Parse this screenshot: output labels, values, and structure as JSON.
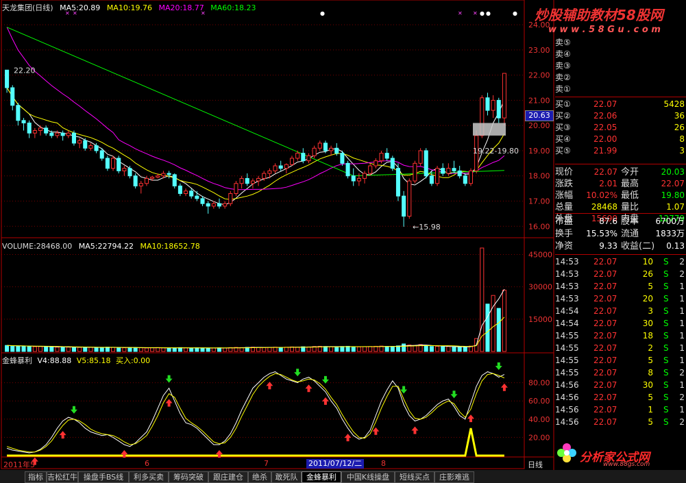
{
  "chart_data": [
    {
      "type": "candlestick",
      "title": "天龙集团(日线)",
      "ma_legend": [
        {
          "label": "MA5:20.89",
          "color": "#ffffff"
        },
        {
          "label": "MA10:19.76",
          "color": "#ffff00"
        },
        {
          "label": "MA20:18.77",
          "color": "#ff00ff"
        },
        {
          "label": "MA60:18.23",
          "color": "#00ff00"
        }
      ],
      "ylim": [
        15.6,
        24.6
      ],
      "yticks": [
        "24.00",
        "23.00",
        "22.00",
        "21.00",
        "20.00",
        "19.00",
        "18.00",
        "17.00",
        "16.00"
      ],
      "current_price": "20.63",
      "annotations": [
        "22.20",
        "19.22-19.80",
        "←15.98"
      ],
      "ohlc": [
        [
          22.2,
          22.2,
          21.3,
          21.5
        ],
        [
          21.5,
          21.6,
          20.6,
          20.8
        ],
        [
          20.8,
          20.9,
          20.0,
          20.2
        ],
        [
          20.2,
          20.3,
          19.8,
          20.1
        ],
        [
          20.1,
          20.2,
          19.5,
          19.7
        ],
        [
          19.7,
          19.9,
          19.5,
          19.8
        ],
        [
          19.8,
          20.0,
          19.6,
          19.9
        ],
        [
          19.9,
          20.0,
          19.6,
          19.7
        ],
        [
          19.7,
          19.8,
          19.5,
          19.6
        ],
        [
          19.6,
          19.8,
          19.5,
          19.7
        ],
        [
          19.7,
          19.8,
          19.4,
          19.6
        ],
        [
          19.6,
          19.8,
          19.5,
          19.7
        ],
        [
          19.7,
          19.8,
          19.2,
          19.3
        ],
        [
          19.3,
          19.5,
          19.1,
          19.4
        ],
        [
          19.4,
          19.5,
          19.0,
          19.1
        ],
        [
          19.1,
          19.3,
          19.0,
          19.2
        ],
        [
          19.2,
          19.3,
          18.9,
          19.0
        ],
        [
          19.0,
          19.1,
          18.6,
          18.7
        ],
        [
          18.7,
          18.8,
          18.2,
          18.3
        ],
        [
          18.3,
          18.8,
          18.2,
          18.7
        ],
        [
          18.7,
          18.8,
          18.1,
          18.2
        ],
        [
          18.2,
          18.4,
          18.0,
          18.3
        ],
        [
          18.3,
          18.4,
          17.9,
          18.0
        ],
        [
          18.0,
          18.1,
          17.5,
          17.6
        ],
        [
          17.6,
          17.8,
          17.3,
          17.7
        ],
        [
          17.7,
          18.0,
          17.6,
          17.9
        ],
        [
          17.9,
          18.0,
          17.8,
          17.95
        ],
        [
          17.95,
          18.1,
          17.9,
          18.0
        ],
        [
          18.0,
          18.2,
          17.9,
          18.1
        ],
        [
          18.1,
          18.2,
          17.9,
          18.05
        ],
        [
          18.05,
          18.1,
          17.5,
          17.6
        ],
        [
          17.6,
          17.7,
          17.2,
          17.3
        ],
        [
          17.3,
          17.5,
          17.2,
          17.4
        ],
        [
          17.4,
          17.5,
          17.1,
          17.2
        ],
        [
          17.2,
          17.4,
          17.0,
          17.1
        ],
        [
          17.1,
          17.2,
          16.8,
          16.9
        ],
        [
          16.9,
          17.0,
          16.5,
          16.8
        ],
        [
          16.8,
          17.0,
          16.7,
          16.9
        ],
        [
          16.9,
          17.1,
          16.7,
          16.8
        ],
        [
          16.8,
          17.0,
          16.7,
          16.9
        ],
        [
          16.9,
          17.4,
          16.8,
          17.3
        ],
        [
          17.3,
          17.8,
          17.2,
          17.7
        ],
        [
          17.7,
          18.0,
          17.5,
          17.9
        ],
        [
          17.9,
          18.1,
          17.6,
          17.7
        ],
        [
          17.7,
          17.9,
          17.5,
          17.8
        ],
        [
          17.8,
          18.0,
          17.6,
          17.9
        ],
        [
          17.9,
          18.2,
          17.8,
          18.1
        ],
        [
          18.1,
          18.3,
          17.9,
          18.2
        ],
        [
          18.2,
          18.5,
          18.1,
          18.4
        ],
        [
          18.4,
          18.6,
          18.2,
          18.3
        ],
        [
          18.3,
          18.5,
          18.1,
          18.45
        ],
        [
          18.45,
          18.8,
          18.4,
          18.7
        ],
        [
          18.7,
          19.0,
          18.6,
          18.9
        ],
        [
          18.9,
          19.1,
          18.5,
          18.6
        ],
        [
          18.6,
          18.9,
          18.5,
          18.8
        ],
        [
          18.8,
          19.2,
          18.7,
          19.1
        ],
        [
          19.1,
          19.4,
          19.0,
          19.3
        ],
        [
          19.3,
          19.4,
          18.9,
          19.0
        ],
        [
          19.0,
          19.2,
          18.8,
          19.1
        ],
        [
          19.1,
          19.3,
          18.8,
          18.9
        ],
        [
          18.9,
          19.0,
          18.4,
          18.5
        ],
        [
          18.5,
          18.6,
          17.9,
          18.0
        ],
        [
          18.0,
          18.3,
          17.6,
          17.8
        ],
        [
          17.8,
          18.1,
          17.6,
          17.9
        ],
        [
          17.9,
          18.2,
          17.7,
          18.1
        ],
        [
          18.1,
          18.5,
          18.0,
          18.4
        ],
        [
          18.4,
          18.7,
          18.3,
          18.6
        ],
        [
          18.6,
          19.0,
          18.5,
          18.9
        ],
        [
          18.9,
          19.1,
          18.6,
          18.7
        ],
        [
          18.7,
          18.8,
          18.2,
          18.3
        ],
        [
          18.3,
          18.5,
          17.0,
          17.2
        ],
        [
          17.2,
          17.4,
          15.98,
          16.4
        ],
        [
          16.4,
          17.9,
          16.3,
          17.8
        ],
        [
          17.8,
          18.6,
          17.7,
          18.5
        ],
        [
          18.5,
          19.1,
          18.4,
          19.0
        ],
        [
          19.0,
          19.1,
          17.9,
          18.0
        ],
        [
          18.0,
          18.2,
          17.6,
          17.7
        ],
        [
          17.7,
          18.4,
          17.6,
          18.3
        ],
        [
          18.3,
          18.5,
          18.0,
          18.1
        ],
        [
          18.1,
          18.5,
          18.0,
          18.3
        ],
        [
          18.3,
          18.6,
          18.1,
          18.2
        ],
        [
          18.2,
          18.4,
          17.9,
          18.0
        ],
        [
          18.0,
          18.1,
          17.6,
          17.7
        ],
        [
          17.7,
          18.3,
          17.6,
          18.2
        ],
        [
          18.2,
          19.8,
          18.1,
          19.6
        ],
        [
          19.6,
          21.2,
          19.5,
          21.1
        ],
        [
          21.1,
          21.3,
          20.4,
          20.6
        ],
        [
          20.6,
          21.2,
          20.3,
          21.0
        ],
        [
          21.0,
          21.1,
          20.1,
          20.3
        ],
        [
          20.3,
          22.07,
          20.0,
          22.07
        ]
      ]
    },
    {
      "type": "bar",
      "title": "VOLUME:28468.00",
      "ma_legend": [
        {
          "label": "MA5:22794.22",
          "color": "#ffffff"
        },
        {
          "label": "MA10:18652.78",
          "color": "#ffff00"
        }
      ],
      "ylim": [
        0,
        48000
      ],
      "yticks": [
        "45000",
        "30000",
        "15000"
      ],
      "values": [
        2800,
        2600,
        2500,
        2400,
        2300,
        2200,
        2300,
        2200,
        2100,
        2000,
        2100,
        2000,
        1900,
        1900,
        2000,
        1900,
        1800,
        1800,
        2000,
        1900,
        1800,
        1700,
        1800,
        1800,
        1700,
        1600,
        1700,
        1800,
        1700,
        1600,
        1700,
        1800,
        1700,
        1600,
        1700,
        1600,
        1500,
        1600,
        1700,
        1600,
        1800,
        1900,
        1800,
        1900,
        2000,
        1900,
        1800,
        1900,
        2000,
        1900,
        2000,
        2100,
        2000,
        2200,
        2100,
        2300,
        2400,
        2300,
        2200,
        2100,
        2300,
        2400,
        2200,
        2100,
        2200,
        2300,
        2400,
        2500,
        2300,
        2200,
        2600,
        3500,
        3000,
        2800,
        3200,
        2500,
        2300,
        2400,
        2200,
        2300,
        2100,
        2000,
        2100,
        2500,
        6000,
        48000,
        22000,
        26000,
        20000,
        28468
      ]
    },
    {
      "type": "line",
      "title": "金蜂暴利",
      "legend": [
        {
          "label": "V4:88.88",
          "color": "#ffffff"
        },
        {
          "label": "V5:85.18",
          "color": "#ffff00"
        },
        {
          "label": "买入:0.00",
          "color": "#ffff00"
        }
      ],
      "ylim": [
        0,
        100
      ],
      "yticks": [
        "80.00",
        "60.00",
        "40.00",
        "20.00"
      ],
      "series": [
        {
          "values": [
            8,
            6,
            5,
            4,
            3,
            4,
            7,
            12,
            20,
            30,
            38,
            42,
            40,
            36,
            30,
            26,
            24,
            22,
            23,
            20,
            16,
            12,
            10,
            14,
            20,
            26,
            38,
            52,
            66,
            74,
            60,
            46,
            36,
            34,
            30,
            24,
            18,
            12,
            12,
            16,
            24,
            36,
            50,
            62,
            74,
            80,
            86,
            90,
            92,
            88,
            84,
            82,
            80,
            84,
            86,
            82,
            76,
            70,
            60,
            52,
            40,
            30,
            22,
            18,
            20,
            28,
            44,
            60,
            72,
            82,
            74,
            56,
            44,
            38,
            40,
            44,
            50,
            56,
            60,
            62,
            54,
            44,
            40,
            58,
            76,
            88,
            92,
            90,
            86,
            89
          ]
        },
        {
          "values": [
            10,
            8,
            6,
            5,
            4,
            4,
            6,
            10,
            16,
            25,
            33,
            39,
            40,
            38,
            34,
            29,
            26,
            24,
            23,
            22,
            19,
            15,
            12,
            13,
            17,
            22,
            32,
            44,
            58,
            68,
            64,
            52,
            41,
            36,
            32,
            27,
            21,
            15,
            13,
            14,
            20,
            30,
            43,
            55,
            67,
            76,
            82,
            87,
            90,
            89,
            86,
            83,
            81,
            82,
            84,
            83,
            79,
            73,
            64,
            56,
            45,
            35,
            26,
            20,
            19,
            24,
            37,
            52,
            65,
            76,
            76,
            62,
            49,
            41,
            40,
            42,
            47,
            53,
            57,
            60,
            57,
            48,
            42,
            51,
            68,
            82,
            89,
            90,
            88,
            85.18
          ]
        }
      ],
      "buy_line": [
        0,
        0,
        0,
        0,
        0,
        0,
        0,
        0,
        0,
        0,
        0,
        0,
        0,
        0,
        0,
        0,
        0,
        0,
        0,
        0,
        0,
        0,
        0,
        0,
        0,
        0,
        0,
        0,
        0,
        0,
        0,
        0,
        0,
        0,
        0,
        0,
        0,
        0,
        0,
        0,
        0,
        0,
        0,
        0,
        0,
        0,
        0,
        0,
        0,
        0,
        0,
        0,
        0,
        0,
        0,
        0,
        0,
        0,
        0,
        0,
        0,
        0,
        0,
        0,
        0,
        0,
        0,
        0,
        0,
        0,
        0,
        0,
        0,
        0,
        0,
        0,
        0,
        0,
        0,
        0,
        0,
        0,
        0,
        0,
        0,
        0,
        0,
        0,
        0,
        0
      ],
      "buy_spike": {
        "index": 83,
        "value": 30
      },
      "up_arrows": [
        5,
        10,
        21,
        29,
        38,
        47,
        54,
        57,
        61,
        66,
        73,
        83,
        90
      ],
      "down_arrows": [
        12,
        29,
        52,
        57,
        71,
        80,
        88
      ]
    }
  ],
  "header": {
    "date_marker": "2011/07/12/二",
    "x_labels": [
      "2011年5",
      "6",
      "7",
      "8"
    ]
  },
  "watermark": {
    "top": "炒股辅助教材58股网",
    "url": "w w w . 5 8 G u . c o m",
    "bottom": "分析家公式网",
    "bottom_url": "www.88gs.com"
  },
  "quote": {
    "asks": [
      {
        "label": "卖⑤"
      },
      {
        "label": "卖④"
      },
      {
        "label": "卖③"
      },
      {
        "label": "卖②"
      },
      {
        "label": "卖①"
      }
    ],
    "bids": [
      {
        "label": "买①",
        "price": "22.07",
        "vol": "5428"
      },
      {
        "label": "买②",
        "price": "22.06",
        "vol": "36"
      },
      {
        "label": "买③",
        "price": "22.05",
        "vol": "26"
      },
      {
        "label": "买④",
        "price": "22.00",
        "vol": "8"
      },
      {
        "label": "买⑤",
        "price": "21.99",
        "vol": "3"
      }
    ],
    "stats": [
      {
        "k1": "现价",
        "v1": "22.07",
        "k2": "今开",
        "v2": "20.03"
      },
      {
        "k1": "涨跌",
        "v1": "2.01",
        "k2": "最高",
        "v2": "22.07"
      },
      {
        "k1": "涨幅",
        "v1": "10.02%",
        "k2": "最低",
        "v2": "19.80"
      },
      {
        "k1": "总量",
        "v1": "28468",
        "k2": "量比",
        "v2": "1.07"
      },
      {
        "k1": "外盘",
        "v1": "15690",
        "k2": "内盘",
        "v2": "12779"
      }
    ],
    "fund": [
      {
        "k1": "市盈",
        "v1": "87.6",
        "k2": "股本",
        "v2": "6700万"
      },
      {
        "k1": "换手",
        "v1": "15.53%",
        "k2": "流通",
        "v2": "1833万"
      },
      {
        "k1": "净资",
        "v1": "9.33",
        "k2": "收益(二)",
        "v2": "0.13"
      }
    ],
    "ticks": [
      {
        "t": "14:53",
        "p": "22.07",
        "v": "10",
        "s": "S",
        "n": "2"
      },
      {
        "t": "14:53",
        "p": "22.07",
        "v": "26",
        "s": "S",
        "n": "2"
      },
      {
        "t": "14:53",
        "p": "22.07",
        "v": "5",
        "s": "S",
        "n": "1"
      },
      {
        "t": "14:53",
        "p": "22.07",
        "v": "20",
        "s": "S",
        "n": "1"
      },
      {
        "t": "14:54",
        "p": "22.07",
        "v": "3",
        "s": "S",
        "n": "1"
      },
      {
        "t": "14:54",
        "p": "22.07",
        "v": "30",
        "s": "S",
        "n": "1"
      },
      {
        "t": "14:55",
        "p": "22.07",
        "v": "18",
        "s": "S",
        "n": "1"
      },
      {
        "t": "14:55",
        "p": "22.07",
        "v": "2",
        "s": "S",
        "n": "1"
      },
      {
        "t": "14:55",
        "p": "22.07",
        "v": "5",
        "s": "S",
        "n": "1"
      },
      {
        "t": "14:55",
        "p": "22.07",
        "v": "8",
        "s": "S",
        "n": "2"
      },
      {
        "t": "14:56",
        "p": "22.07",
        "v": "30",
        "s": "S",
        "n": "1"
      },
      {
        "t": "14:56",
        "p": "22.07",
        "v": "5",
        "s": "S",
        "n": "2"
      },
      {
        "t": "14:56",
        "p": "22.07",
        "v": "1",
        "s": "S",
        "n": "1"
      },
      {
        "t": "14:56",
        "p": "22.07",
        "v": "5",
        "s": "S",
        "n": "2"
      }
    ],
    "daily_label": "日线"
  },
  "tabs": [
    "指标",
    "吉松红牛",
    "操盘手BS线",
    "利多买卖",
    "筹码突破",
    "跟庄建仓",
    "绝杀",
    "敢死队",
    "金蜂暴利",
    "中国K线操盘",
    "短线买点",
    "庄影难逃"
  ],
  "active_tab": "金蜂暴利",
  "colors": {
    "up": "#ff3232",
    "down": "#54ffff",
    "grid": "#7a0000",
    "axis": "#b40000"
  }
}
